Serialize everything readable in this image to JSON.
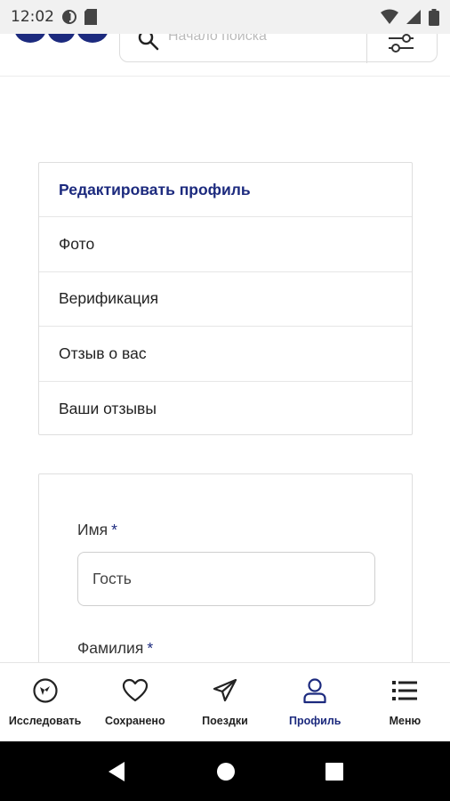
{
  "status_bar": {
    "time": "12:02"
  },
  "header": {
    "search_placeholder": "Начало поиска"
  },
  "profile_menu": {
    "items": [
      {
        "label": "Редактировать профиль",
        "active": true
      },
      {
        "label": "Фото",
        "active": false
      },
      {
        "label": "Верификация",
        "active": false
      },
      {
        "label": "Отзыв о вас",
        "active": false
      },
      {
        "label": "Ваши отзывы",
        "active": false
      }
    ]
  },
  "form": {
    "first_name_label": "Имя",
    "first_name_required_mark": "*",
    "first_name_value": "Гость",
    "last_name_label": "Фамилия",
    "last_name_required_mark": "*"
  },
  "bottom_nav": {
    "items": [
      {
        "label": "Исследовать",
        "icon": "compass-icon"
      },
      {
        "label": "Сохранено",
        "icon": "heart-icon"
      },
      {
        "label": "Поездки",
        "icon": "paper-plane-icon"
      },
      {
        "label": "Профиль",
        "icon": "user-icon",
        "active": true
      },
      {
        "label": "Меню",
        "icon": "menu-list-icon"
      }
    ]
  },
  "colors": {
    "brand": "#1c2a7e",
    "text": "#222222",
    "border": "#dedede"
  }
}
